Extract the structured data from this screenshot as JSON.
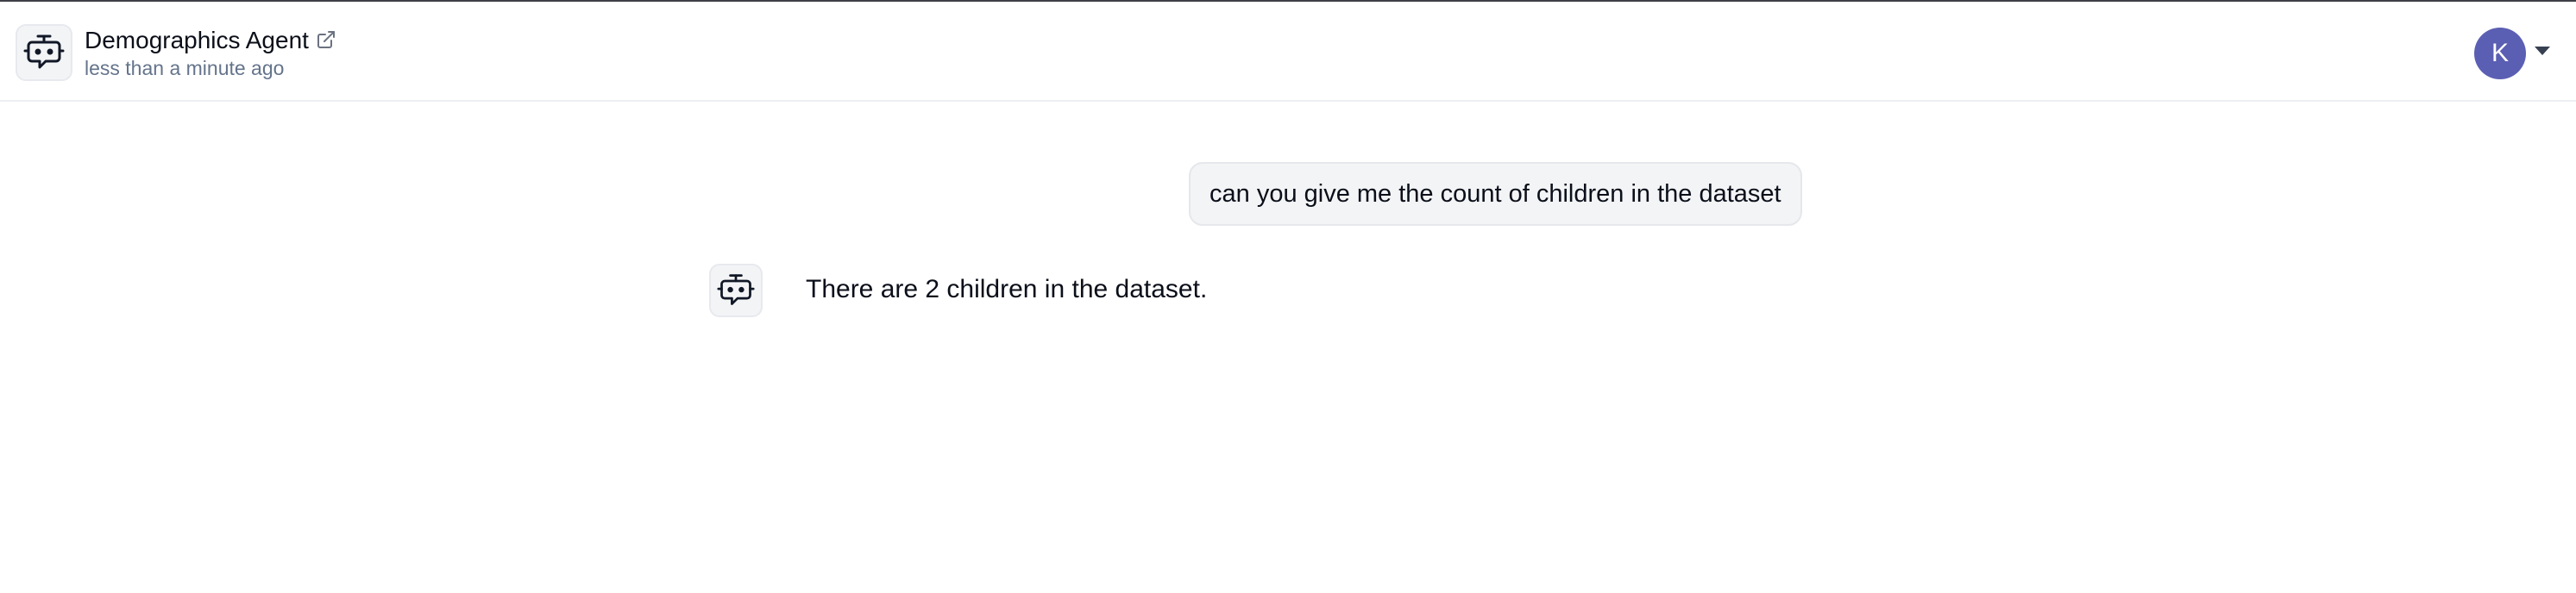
{
  "header": {
    "agent_icon": "robot-chat-icon",
    "agent_name": "Demographics Agent",
    "external_link_icon": "external-link-icon",
    "timestamp": "less than a minute ago",
    "user_initial": "K",
    "user_menu_icon": "caret-down-icon",
    "user_avatar_color": "#5b5fb3"
  },
  "conversation": {
    "messages": [
      {
        "role": "user",
        "text": "can you give me the count of children in the dataset"
      },
      {
        "role": "assistant",
        "icon": "robot-chat-icon",
        "text": "There are 2 children in the dataset."
      }
    ]
  }
}
